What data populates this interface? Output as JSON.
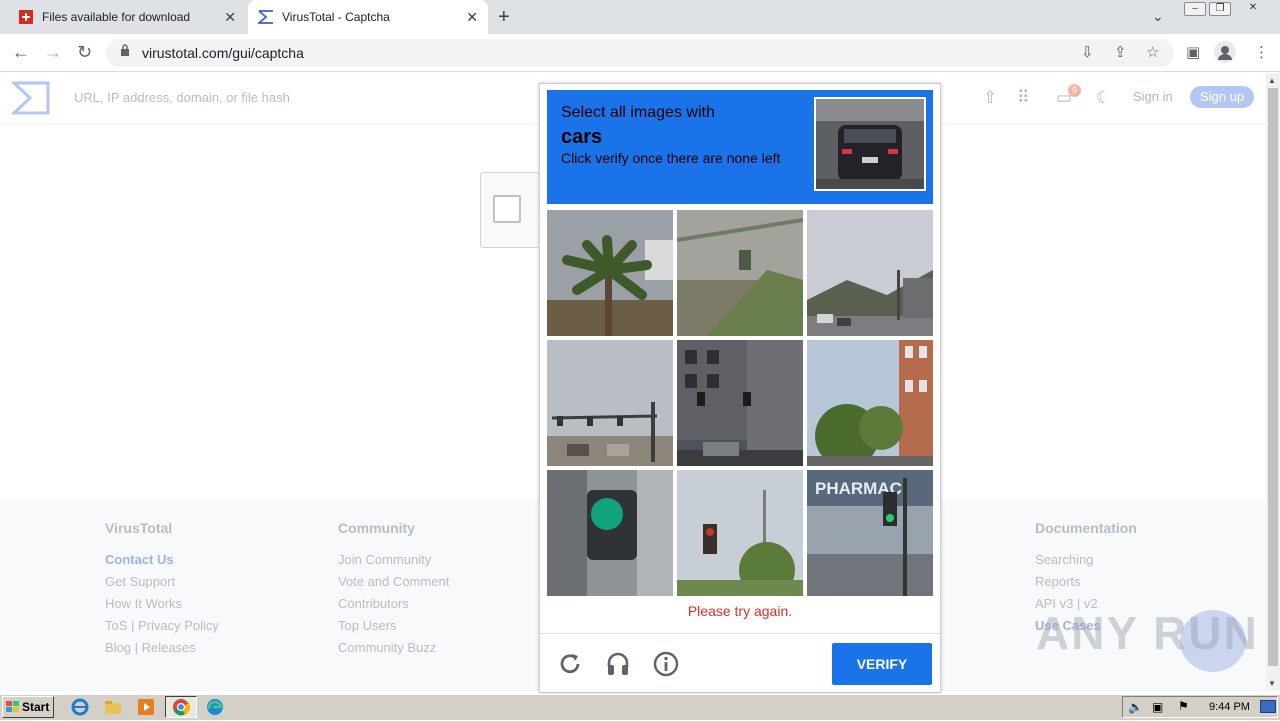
{
  "browser": {
    "tabs": [
      {
        "title": "Files available for download",
        "active": false
      },
      {
        "title": "VirusTotal - Captcha",
        "active": true
      }
    ],
    "url": "virustotal.com/gui/captcha"
  },
  "vt": {
    "search_placeholder": "URL, IP address, domain, or file hash",
    "signin": "Sign in",
    "signup": "Sign up",
    "notif_count": "9"
  },
  "footer": {
    "columns": [
      {
        "heading": "VirusTotal",
        "links": [
          "Contact Us",
          "Get Support",
          "How It Works",
          "ToS | Privacy Policy",
          "Blog | Releases"
        ]
      },
      {
        "heading": "Community",
        "links": [
          "Join Community",
          "Vote and Comment",
          "Contributors",
          "Top Users",
          "Community Buzz"
        ]
      },
      {
        "heading": "Documentation",
        "links": [
          "Searching",
          "Reports",
          "API v3 | v2",
          "Use Cases"
        ]
      }
    ]
  },
  "challenge": {
    "line1": "Select all images with",
    "keyword": "cars",
    "line3": "Click verify once there are none left",
    "error": "Please try again.",
    "verify_label": "VERIFY",
    "tiles": [
      "palm-tree",
      "roadside-grass",
      "highway-sky",
      "traffic-lights-intersection",
      "building-traffic-lights",
      "brick-building-trees",
      "green-traffic-light",
      "traffic-light-pole",
      "pharmacy-traffic-light"
    ],
    "pharmacy_text": "PHARMAC"
  },
  "watermark": "ANY RUN",
  "taskbar": {
    "start": "Start",
    "clock": "9:44 PM"
  },
  "colors": {
    "accent": "#1a73e8",
    "error": "#d93025"
  }
}
